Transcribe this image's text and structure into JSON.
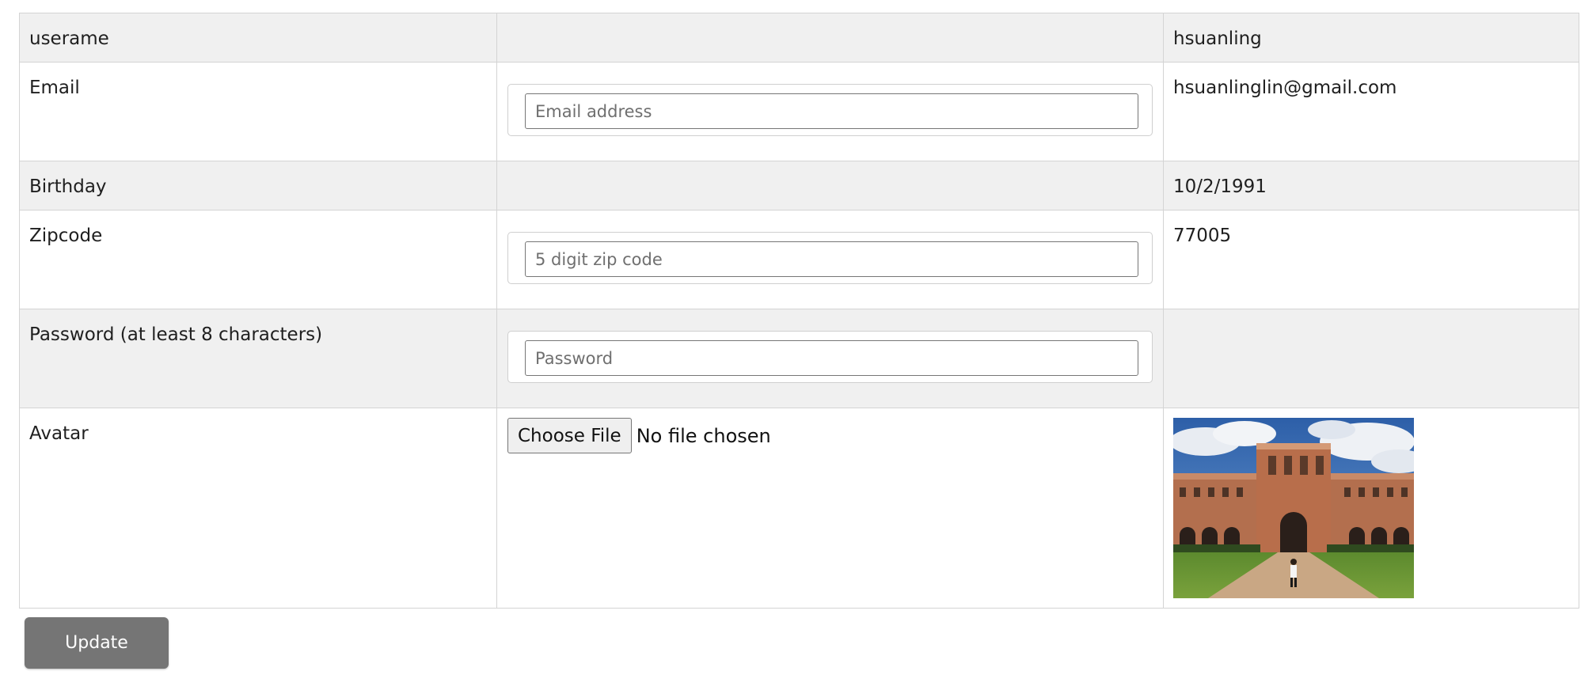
{
  "form": {
    "rows": {
      "username": {
        "label": "userame",
        "current_value": "hsuanling"
      },
      "email": {
        "label": "Email",
        "placeholder": "Email address",
        "input_value": "",
        "current_value": "hsuanlinglin@gmail.com"
      },
      "birthday": {
        "label": "Birthday",
        "current_value": "10/2/1991"
      },
      "zipcode": {
        "label": "Zipcode",
        "placeholder": "5 digit zip code",
        "input_value": "",
        "current_value": "77005"
      },
      "password": {
        "label": "Password (at least 8 characters)",
        "placeholder": "Password",
        "input_value": "",
        "current_value": ""
      },
      "avatar": {
        "label": "Avatar",
        "file_button_label": "Choose File",
        "file_status": "No file chosen"
      }
    },
    "update_label": "Update"
  },
  "colors": {
    "shaded_row": "#f0f0f0",
    "border": "#d4d4d4",
    "update_button": "#757575",
    "update_text": "#ffffff"
  }
}
